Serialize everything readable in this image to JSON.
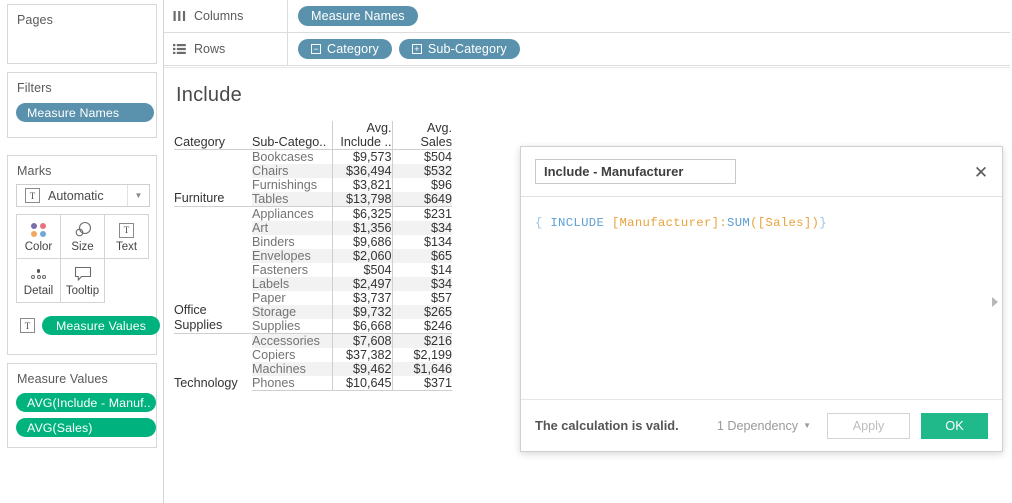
{
  "sidebar": {
    "pages": {
      "title": "Pages"
    },
    "filters": {
      "title": "Filters",
      "pill_label": "Measure Names"
    },
    "marks": {
      "title": "Marks",
      "mark_type": "Automatic",
      "mark_type_icon": "text-T-icon",
      "buttons": [
        {
          "label": "Color",
          "icon": "color-dots-icon"
        },
        {
          "label": "Size",
          "icon": "size-circles-icon"
        },
        {
          "label": "Text",
          "icon": "text-T-icon"
        },
        {
          "label": "Detail",
          "icon": "detail-dots-icon"
        },
        {
          "label": "Tooltip",
          "icon": "tooltip-bubble-icon"
        }
      ],
      "text_pill_label": "Measure Values"
    },
    "measure_values": {
      "title": "Measure Values",
      "pills": [
        "AVG(Include - Manuf..",
        "AVG(Sales)"
      ]
    }
  },
  "shelves": {
    "columns": {
      "label": "Columns",
      "icon": "columns-bars-icon",
      "pills": [
        {
          "label": "Measure Names",
          "prefix": ""
        }
      ]
    },
    "rows": {
      "label": "Rows",
      "icon": "rows-lines-icon",
      "pills": [
        {
          "label": "Category",
          "prefix": "−"
        },
        {
          "label": "Sub-Category",
          "prefix": "+"
        }
      ]
    }
  },
  "viz": {
    "title": "Include",
    "headers": {
      "category": "Category",
      "sub_category": "Sub-Catego..",
      "col3_line1": "Avg.",
      "col3_line2": "Include ..",
      "col4_line1": "Avg.",
      "col4_line2": "Sales"
    },
    "rows": [
      {
        "category": "Furniture",
        "sub": "Bookcases",
        "avg_include": "$9,573",
        "avg_sales": "$504",
        "group_start": true,
        "stripe": false
      },
      {
        "category": "",
        "sub": "Chairs",
        "avg_include": "$36,494",
        "avg_sales": "$532",
        "group_start": false,
        "stripe": true
      },
      {
        "category": "",
        "sub": "Furnishings",
        "avg_include": "$3,821",
        "avg_sales": "$96",
        "group_start": false,
        "stripe": false
      },
      {
        "category": "",
        "sub": "Tables",
        "avg_include": "$13,798",
        "avg_sales": "$649",
        "group_start": false,
        "stripe": true
      },
      {
        "category": "Office Supplies",
        "sub": "Appliances",
        "avg_include": "$6,325",
        "avg_sales": "$231",
        "group_start": true,
        "stripe": false
      },
      {
        "category": "",
        "sub": "Art",
        "avg_include": "$1,356",
        "avg_sales": "$34",
        "group_start": false,
        "stripe": true
      },
      {
        "category": "",
        "sub": "Binders",
        "avg_include": "$9,686",
        "avg_sales": "$134",
        "group_start": false,
        "stripe": false
      },
      {
        "category": "",
        "sub": "Envelopes",
        "avg_include": "$2,060",
        "avg_sales": "$65",
        "group_start": false,
        "stripe": true
      },
      {
        "category": "",
        "sub": "Fasteners",
        "avg_include": "$504",
        "avg_sales": "$14",
        "group_start": false,
        "stripe": false
      },
      {
        "category": "",
        "sub": "Labels",
        "avg_include": "$2,497",
        "avg_sales": "$34",
        "group_start": false,
        "stripe": true
      },
      {
        "category": "",
        "sub": "Paper",
        "avg_include": "$3,737",
        "avg_sales": "$57",
        "group_start": false,
        "stripe": false
      },
      {
        "category": "",
        "sub": "Storage",
        "avg_include": "$9,732",
        "avg_sales": "$265",
        "group_start": false,
        "stripe": true
      },
      {
        "category": "",
        "sub": "Supplies",
        "avg_include": "$6,668",
        "avg_sales": "$246",
        "group_start": false,
        "stripe": false
      },
      {
        "category": "Technology",
        "sub": "Accessories",
        "avg_include": "$7,608",
        "avg_sales": "$216",
        "group_start": true,
        "stripe": true
      },
      {
        "category": "",
        "sub": "Copiers",
        "avg_include": "$37,382",
        "avg_sales": "$2,199",
        "group_start": false,
        "stripe": false
      },
      {
        "category": "",
        "sub": "Machines",
        "avg_include": "$9,462",
        "avg_sales": "$1,646",
        "group_start": false,
        "stripe": true
      },
      {
        "category": "",
        "sub": "Phones",
        "avg_include": "$10,645",
        "avg_sales": "$371",
        "group_start": false,
        "stripe": false
      }
    ]
  },
  "calc_dialog": {
    "name_value": "Include - Manufacturer",
    "close_icon": "close-icon",
    "expand_icon": "expand-right-arrow-icon",
    "formula_tokens": [
      {
        "text": "{",
        "kind": "brace"
      },
      {
        "text": " INCLUDE ",
        "kind": "kw"
      },
      {
        "text": "[Manufacturer]",
        "kind": "field"
      },
      {
        "text": ":",
        "kind": "punc"
      },
      {
        "text": "SUM",
        "kind": "func"
      },
      {
        "text": "(",
        "kind": "punc"
      },
      {
        "text": "[Sales]",
        "kind": "field"
      },
      {
        "text": ")",
        "kind": "punc"
      },
      {
        "text": "}",
        "kind": "brace"
      }
    ],
    "status_text": "The calculation is valid.",
    "dependency_label": "1 Dependency",
    "apply_label": "Apply",
    "ok_label": "OK"
  },
  "colors": {
    "pill_blue": "#5a92ad",
    "pill_green": "#00b37e",
    "ok_green": "#1fb98a",
    "formula_keyword": "#5c9fd4",
    "formula_field": "#e8a33d",
    "formula_brace": "#9ec3dd"
  }
}
